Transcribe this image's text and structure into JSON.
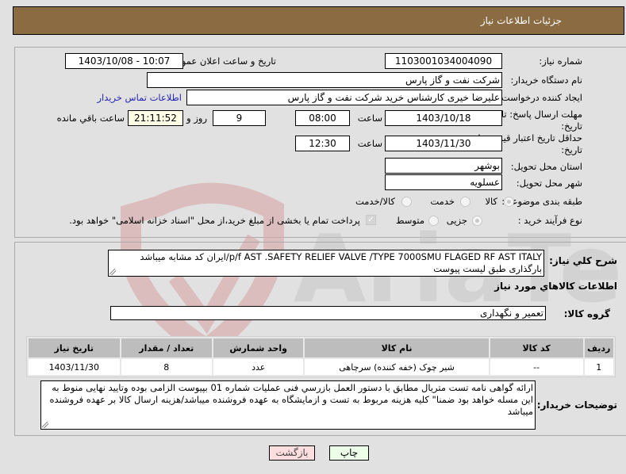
{
  "header": {
    "title": "جزئیات اطلاعات نیاز"
  },
  "form": {
    "need_number": {
      "label": "شماره نیاز:",
      "value": "1103001034004090"
    },
    "announce_datetime": {
      "label": "تاریخ و ساعت اعلان عمومی:",
      "value": "1403/10/08 - 10:07"
    },
    "buyer_org": {
      "label": "نام دستگاه خریدار:",
      "value": "شرکت نفت و گاز پارس"
    },
    "requester": {
      "label": "ایجاد کننده درخواست:",
      "value": "علیرضا  خیری کارشناس خرید  شرکت نفت و گاز پارس"
    },
    "buyer_contact_link": "اطلاعات تماس خریدار",
    "response_deadline": {
      "label_line1": "مهلت ارسال پاسخ: تا",
      "label_line2": "تاریخ:",
      "date": "1403/10/18",
      "time_label": "ساعت",
      "time": "08:00",
      "days": "9",
      "days_label": "روز و",
      "remaining_time": "21:11:52",
      "remaining_label": "ساعت باقي مانده"
    },
    "price_validity": {
      "label_line1": "حداقل تاریخ اعتبار قیمت: تا",
      "label_line2": "تاریخ:",
      "date": "1403/11/30",
      "time_label": "ساعت",
      "time": "12:30"
    },
    "delivery_province": {
      "label": "استان محل تحویل:",
      "value": "بوشهر"
    },
    "delivery_city": {
      "label": "شهر محل تحویل:",
      "value": "عسلویه"
    },
    "category": {
      "label": "طبقه بندی موضوعی:",
      "options": [
        "کالا",
        "خدمت",
        "کالا/خدمت"
      ],
      "selected": "کالا"
    },
    "purchase_type": {
      "label": "نوع فرآیند خرید :",
      "options": [
        "جزیی",
        "متوسط"
      ],
      "selected": "جزیی",
      "payment_note": "پرداخت تمام یا بخشی از مبلغ خرید،از محل \"اسناد خزانه اسلامی\" خواهد بود.",
      "payment_checked": true
    }
  },
  "details": {
    "general_desc_label": "شرح کلي نیاز:",
    "general_desc": "p/f AST .SAFETY RELIEF VALVE /TYPE 7000SMU FLAGED RF AST ITALY/ایران کد مشابه میباشد بارگذاری طبق لیست پیوست",
    "items_section_title": "اطلاعات کالاهاي مورد نیاز",
    "goods_group_label": "گروه کالا:",
    "goods_group": "تعمیر و نگهداری",
    "table": {
      "columns": [
        "ردیف",
        "کد کالا",
        "نام کالا",
        "واحد شمارش",
        "تعداد / مقدار",
        "تاریخ نیاز"
      ],
      "rows": [
        [
          "1",
          "--",
          "شیر چوک (خفه کننده) سرچاهی",
          "عدد",
          "8",
          "1403/11/30"
        ]
      ]
    },
    "buyer_notes_label": "توضیحات خریدار:",
    "buyer_notes": "ارائه گواهی نامه تست متریال مطابق با دستور العمل بازرسي فنی عملیات شماره 01 بپیوست الزامی بوده وتایید نهایی منوط به این مسله خواهد بود ضمنا\" کلیه هزینه مربوط به تست و ازمایشگاه به عهده فروشنده میباشد/هزینه ارسال کالا بر عهده فروشنده میباشد"
  },
  "buttons": {
    "print": "چاپ",
    "back": "بازگشت"
  },
  "watermark": {
    "text": "AriaTender.neT"
  }
}
